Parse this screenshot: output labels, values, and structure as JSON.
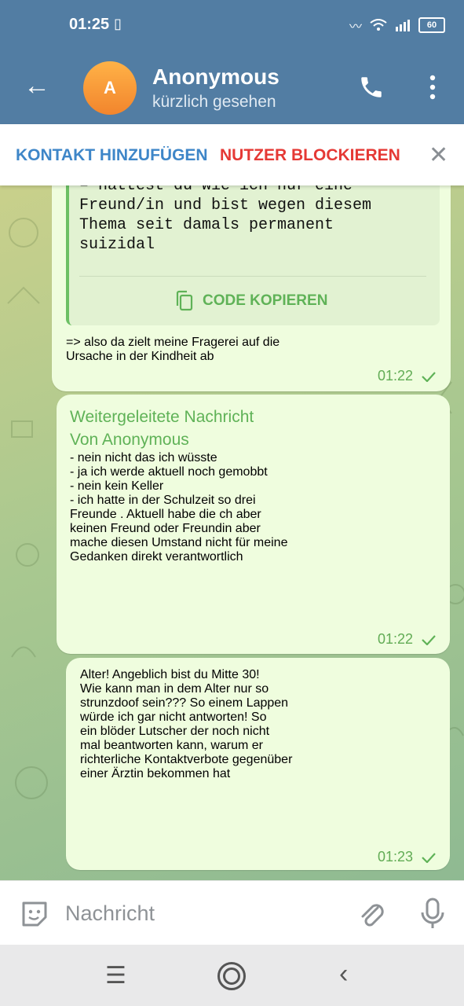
{
  "status_bar": {
    "time": "01:25",
    "battery": "60"
  },
  "header": {
    "back_icon": "arrow-left-icon",
    "avatar_letter": "A",
    "title": "Anonymous",
    "subtitle": "kürzlich gesehen"
  },
  "contact_bar": {
    "add_contact": "KONTAKT HINZUFÜGEN",
    "block_user": "NUTZER BLOCKIEREN"
  },
  "messages": [
    {
      "code_text": "– hattest du wie ich nur eine\nFreund/in und bist wegen diesem\nThema seit damals permanent\nsuizidal",
      "copy_label": "CODE KOPIEREN",
      "text": "=> also da zielt meine Fragerei auf die\nUrsache in der Kindheit ab",
      "time": "01:22"
    },
    {
      "forward_label": "Weitergeleitete Nachricht\nVon Anonymous",
      "text": "- nein nicht das ich wüsste\n- ja ich werde aktuell noch gemobbt\n- nein kein Keller\n- ich hatte in der Schulzeit so drei\nFreunde . Aktuell habe die ch aber\nkeinen Freund oder Freundin aber\nmache diesen Umstand nicht für meine\nGedanken direkt verantwortlich",
      "time": "01:22"
    },
    {
      "text": "Alter! Angeblich bist du Mitte 30!\nWie kann man in dem Alter nur so\nstrunzdoof sein??? So einem Lappen\nwürde ich gar nicht antworten! So\nein blöder Lutscher der noch nicht\nmal beantworten kann, warum er\nrichterliche Kontaktverbote gegenüber\neiner Ärztin bekommen hat",
      "time": "01:23"
    }
  ],
  "input": {
    "placeholder": "Nachricht"
  },
  "colors": {
    "header": "#527da3",
    "bubble": "#effdde",
    "accent_green": "#5fb257",
    "block_red": "#e53935",
    "link_blue": "#3e86c8"
  }
}
